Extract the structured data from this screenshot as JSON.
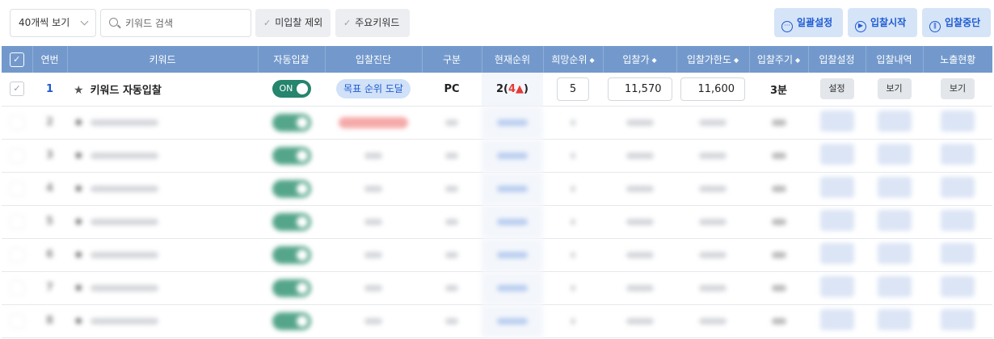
{
  "toolbar": {
    "view_select": "40개씩 보기",
    "search_placeholder": "키워드 검색",
    "filter_exclude": "미입찰 제외",
    "filter_main": "주요키워드",
    "btn_bulk": "일괄설정",
    "btn_start": "입찰시작",
    "btn_stop": "입찰중단"
  },
  "table": {
    "headers": [
      "연번",
      "키워드",
      "자동입찰",
      "입찰진단",
      "구분",
      "현재순위",
      "희망순위",
      "입찰가",
      "입찰가한도",
      "입찰주기",
      "입찰설정",
      "입찰내역",
      "노출현황"
    ],
    "rows": [
      {
        "no": "1",
        "keyword": "키워드 자동입찰",
        "auto": "ON",
        "diagnosis": "목표 순위 도달",
        "type": "PC",
        "rank": "2(",
        "rank_change": "4▲",
        "rank_close": ")",
        "target": "5",
        "bid": "11,570",
        "limit": "11,600",
        "cycle": "3분",
        "setting_btn": "설정",
        "history_btn": "보기",
        "exposure_btn": "보기"
      }
    ],
    "blurred_rows": [
      "2",
      "3",
      "4",
      "5",
      "6",
      "7",
      "8"
    ]
  },
  "colors": {
    "header_bg": "#7399cc",
    "accent": "#1e5bd1",
    "toggle_on": "#25856d",
    "rank_up": "#e53935"
  }
}
